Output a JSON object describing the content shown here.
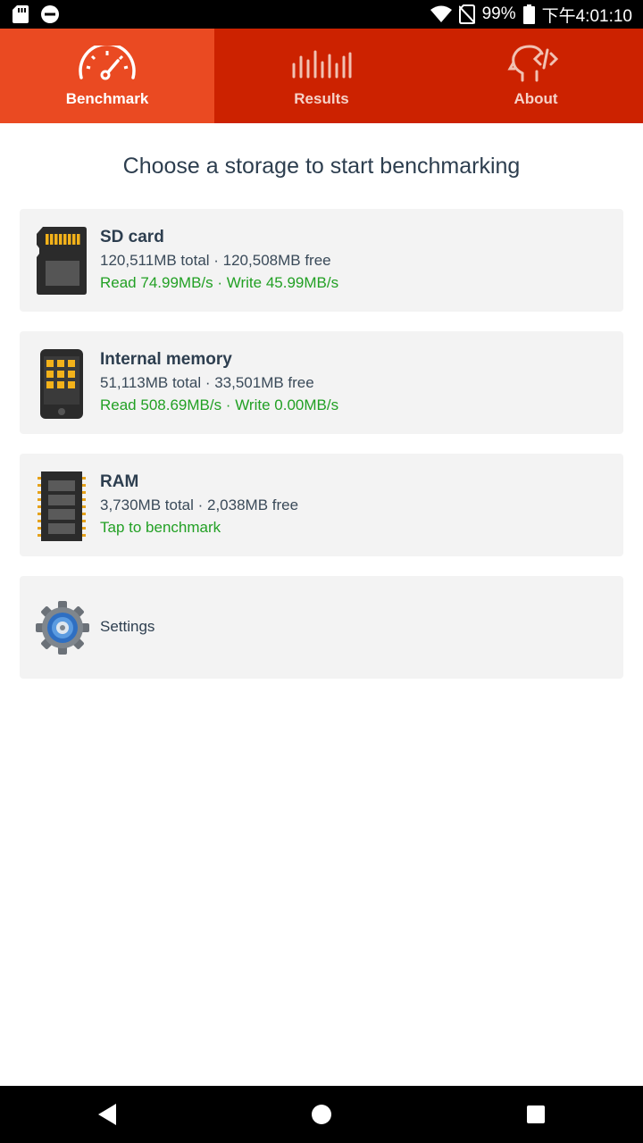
{
  "status_bar": {
    "battery_percent": "99%",
    "time": "下午4:01:10",
    "icons": [
      "sd-card-icon",
      "do-not-disturb-icon",
      "wifi-icon",
      "no-sim-icon",
      "battery-icon"
    ]
  },
  "tabs": [
    {
      "label": "Benchmark",
      "icon": "speedometer-icon",
      "active": true
    },
    {
      "label": "Results",
      "icon": "bars-icon",
      "active": false
    },
    {
      "label": "About",
      "icon": "head-code-icon",
      "active": false
    }
  ],
  "heading": "Choose a storage to start benchmarking",
  "storages": [
    {
      "title": "SD card",
      "details": "120,511MB total · 120,508MB free",
      "speed": "Read 74.99MB/s · Write 45.99MB/s",
      "icon": "sd-card-icon"
    },
    {
      "title": "Internal memory",
      "details": "51,113MB total · 33,501MB free",
      "speed": "Read 508.69MB/s · Write 0.00MB/s",
      "icon": "phone-memory-icon"
    },
    {
      "title": "RAM",
      "details": "3,730MB total · 2,038MB free",
      "speed": "Tap to benchmark",
      "icon": "ram-chip-icon"
    }
  ],
  "settings": {
    "label": "Settings",
    "icon": "gear-icon"
  },
  "nav_bar": {
    "icons": [
      "back-icon",
      "home-icon",
      "recents-icon"
    ]
  },
  "colors": {
    "tab_bar": "#cc2200",
    "tab_active": "#ea4a22",
    "speed_text": "#22a024",
    "title_text": "#2d3e4f",
    "card_bg": "#f3f3f3"
  }
}
